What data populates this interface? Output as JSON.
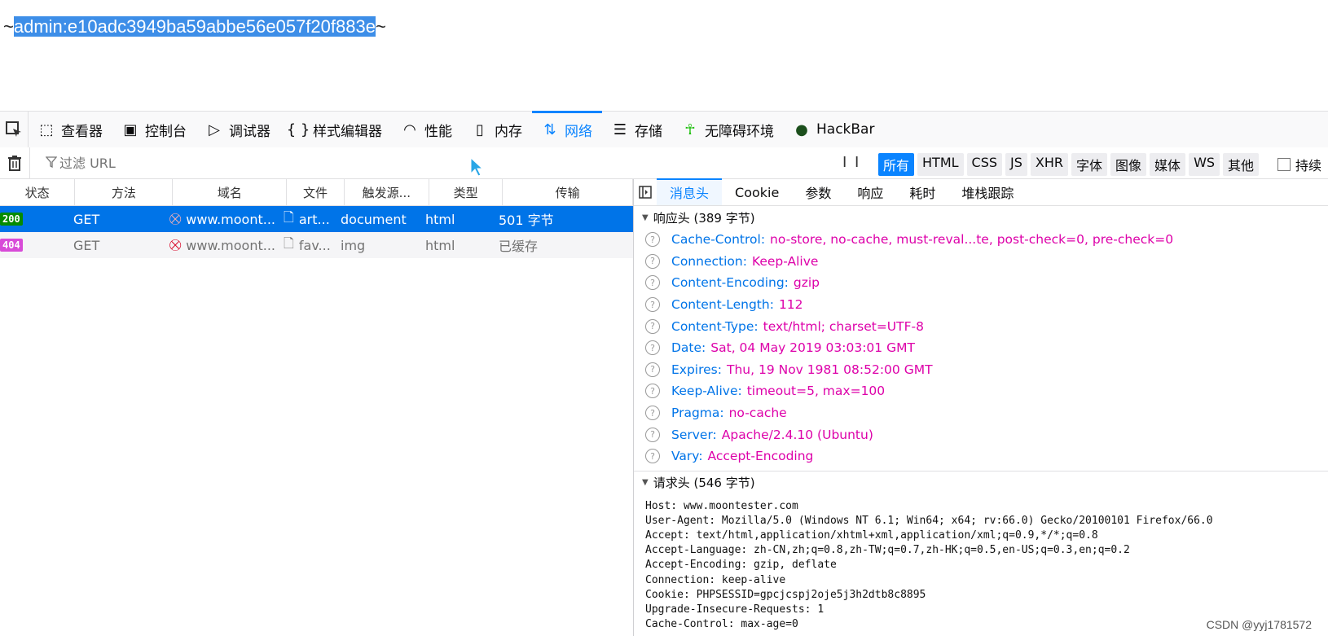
{
  "page": {
    "prefix": "~",
    "selected": "admin:e10adc3949ba59abbe56e057f20f883e",
    "suffix": "~"
  },
  "toolbar": {
    "tabs": [
      {
        "label": "查看器",
        "icon": "inspector-icon"
      },
      {
        "label": "控制台",
        "icon": "console-icon"
      },
      {
        "label": "调试器",
        "icon": "debugger-icon"
      },
      {
        "label": "样式编辑器",
        "icon": "style-editor-icon"
      },
      {
        "label": "性能",
        "icon": "performance-icon"
      },
      {
        "label": "内存",
        "icon": "memory-icon"
      },
      {
        "label": "网络",
        "icon": "network-icon"
      },
      {
        "label": "存储",
        "icon": "storage-icon"
      },
      {
        "label": "无障碍环境",
        "icon": "accessibility-icon"
      },
      {
        "label": "HackBar",
        "icon": "hackbar-icon"
      }
    ]
  },
  "filter": {
    "placeholder": "过滤 URL",
    "pause": "I I",
    "types": [
      "所有",
      "HTML",
      "CSS",
      "JS",
      "XHR",
      "字体",
      "图像",
      "媒体",
      "WS",
      "其他"
    ],
    "persist_label": "持续"
  },
  "table": {
    "headers": [
      "状态",
      "方法",
      "域名",
      "文件",
      "触发源...",
      "类型",
      "传输"
    ],
    "rows": [
      {
        "status": "200",
        "method": "GET",
        "domain": "www.moont...",
        "file": "art...",
        "cause": "document",
        "type": "html",
        "transfer": "501 字节"
      },
      {
        "status": "404",
        "method": "GET",
        "domain": "www.moont...",
        "file": "fav...",
        "cause": "img",
        "type": "html",
        "transfer": "已缓存"
      }
    ]
  },
  "details": {
    "tabs": [
      "消息头",
      "Cookie",
      "参数",
      "响应",
      "耗时",
      "堆栈跟踪"
    ],
    "response_section": "响应头 (389 字节)",
    "response_headers": [
      {
        "name": "Cache-Control:",
        "value": "no-store, no-cache, must-reval...te, post-check=0, pre-check=0"
      },
      {
        "name": "Connection:",
        "value": "Keep-Alive"
      },
      {
        "name": "Content-Encoding:",
        "value": "gzip"
      },
      {
        "name": "Content-Length:",
        "value": "112"
      },
      {
        "name": "Content-Type:",
        "value": "text/html; charset=UTF-8"
      },
      {
        "name": "Date:",
        "value": "Sat, 04 May 2019 03:03:01 GMT"
      },
      {
        "name": "Expires:",
        "value": "Thu, 19 Nov 1981 08:52:00 GMT"
      },
      {
        "name": "Keep-Alive:",
        "value": "timeout=5, max=100"
      },
      {
        "name": "Pragma:",
        "value": "no-cache"
      },
      {
        "name": "Server:",
        "value": "Apache/2.4.10 (Ubuntu)"
      },
      {
        "name": "Vary:",
        "value": "Accept-Encoding"
      }
    ],
    "request_section": "请求头 (546 字节)",
    "request_raw": [
      "Host: www.moontester.com",
      "User-Agent: Mozilla/5.0 (Windows NT 6.1; Win64; x64; rv:66.0) Gecko/20100101 Firefox/66.0",
      "Accept: text/html,application/xhtml+xml,application/xml;q=0.9,*/*;q=0.8",
      "Accept-Language: zh-CN,zh;q=0.8,zh-TW;q=0.7,zh-HK;q=0.5,en-US;q=0.3,en;q=0.2",
      "Accept-Encoding: gzip, deflate",
      "Connection: keep-alive",
      "Cookie: PHPSESSID=gpcjcspj2oje5j3h2dtb8c8895",
      "Upgrade-Insecure-Requests: 1",
      "Cache-Control: max-age=0"
    ]
  },
  "watermark": "CSDN @yyj1781572",
  "colors": {
    "accent": "#0a84ff",
    "header_name": "#0074e8",
    "header_value": "#dd00a9"
  }
}
